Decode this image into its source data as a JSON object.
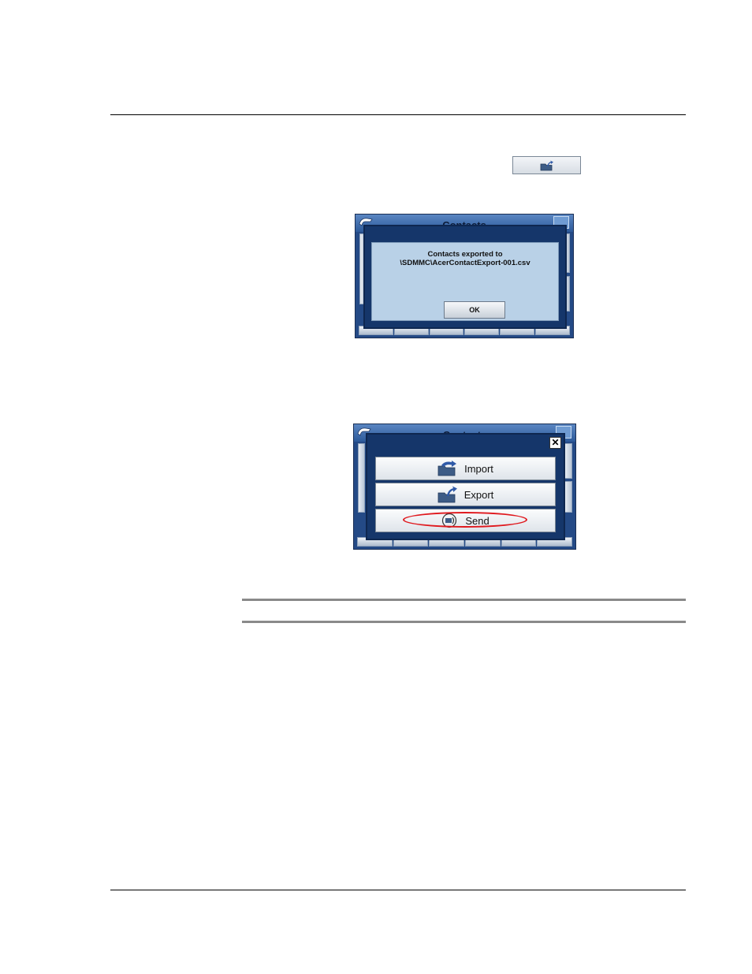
{
  "dialog1": {
    "title": "Contacts",
    "message_line1": "Contacts exported to",
    "message_line2": "\\SDMMC\\AcerContactExport-001.csv",
    "ok_label": "OK"
  },
  "dialog2": {
    "title": "Contacts",
    "import_label": "Import",
    "export_label": "Export",
    "send_label": "Send"
  },
  "colors": {
    "window_blue": "#244a86",
    "dialog_panel": "#b9d1e7",
    "highlight": "#e0191e"
  }
}
